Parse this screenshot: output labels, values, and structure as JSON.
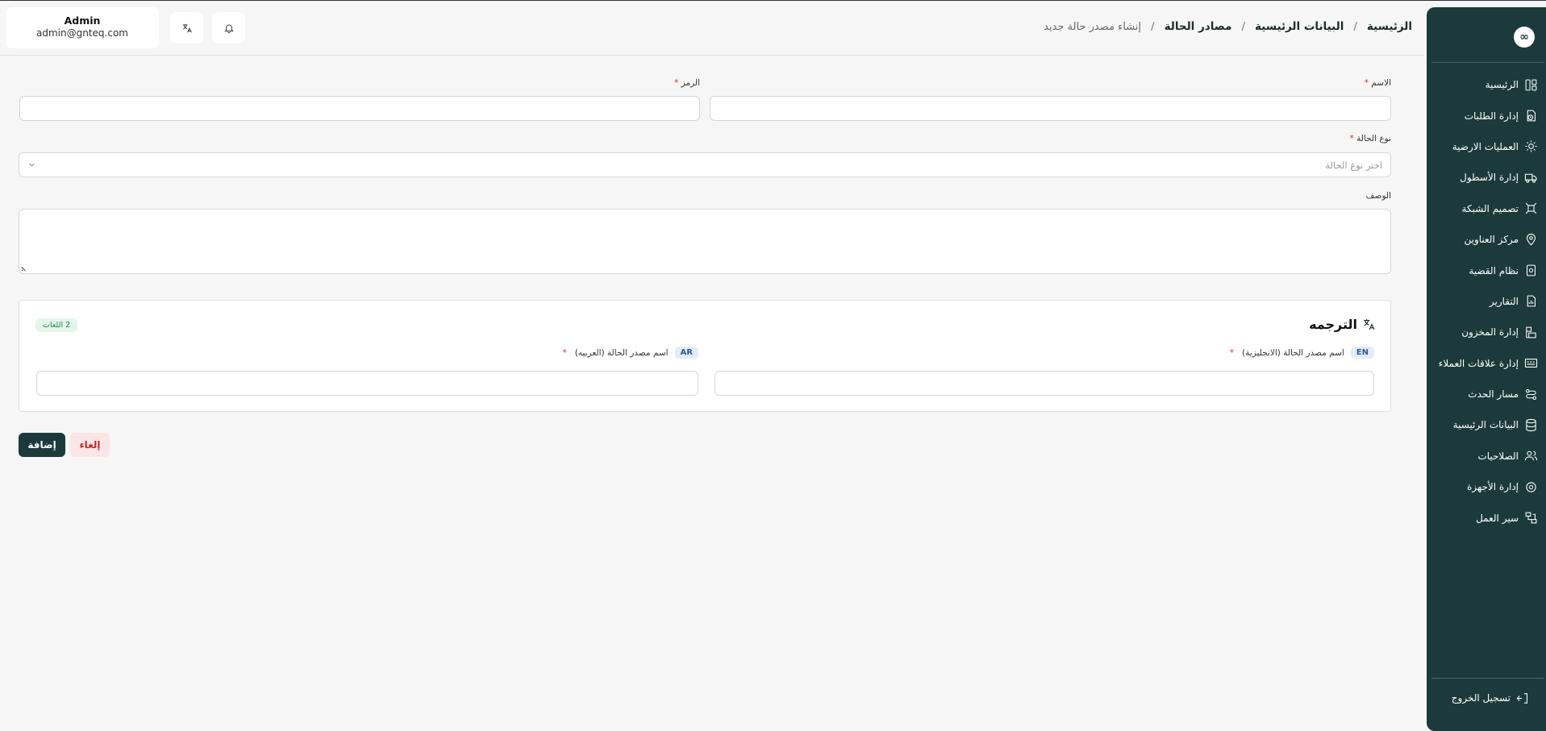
{
  "breadcrumb": {
    "home": "الرئيسية",
    "master_data": "البيانات الرئيسية",
    "status_sources": "مصادر الحالة",
    "current": "إنشاء مصدر حالة جديد",
    "separator": "/"
  },
  "user": {
    "name": "Admin",
    "email": "admin@gnteq.com"
  },
  "header_icons": [
    "translate-icon",
    "bell-icon"
  ],
  "sidebar": {
    "logo_symbol": "∞",
    "items": [
      {
        "label": "الرئيسية",
        "icon": "dashboard-icon"
      },
      {
        "label": "إدارة الطلبات",
        "icon": "orders-icon"
      },
      {
        "label": "العمليات الارضية",
        "icon": "ground-ops-icon"
      },
      {
        "label": "إدارة الأسطول",
        "icon": "truck-icon"
      },
      {
        "label": "تصميم الشبكة",
        "icon": "network-icon"
      },
      {
        "label": "مركز العناوين",
        "icon": "location-icon"
      },
      {
        "label": "نظام القضية",
        "icon": "case-icon"
      },
      {
        "label": "التقارير",
        "icon": "reports-icon"
      },
      {
        "label": "إدارة المخزون",
        "icon": "inventory-icon"
      },
      {
        "label": "إدارة علاقات العملاء",
        "icon": "crm-icon"
      },
      {
        "label": "مسار الحدث",
        "icon": "route-icon"
      },
      {
        "label": "البيانات الرئيسية",
        "icon": "database-icon"
      },
      {
        "label": "الصلاحيات",
        "icon": "users-icon"
      },
      {
        "label": "إدارة الأجهزة",
        "icon": "device-icon"
      },
      {
        "label": "سير العمل",
        "icon": "workflow-icon"
      }
    ],
    "logout": "تسجيل الخروج"
  },
  "form": {
    "name_label": "الاسم",
    "code_label": "الرمز",
    "status_type_label": "نوع الحالة",
    "status_type_placeholder": "اختر نوع الحالة",
    "description_label": "الوصف",
    "required_mark": "*"
  },
  "translation": {
    "title": "الترجمه",
    "badge": "2 اللغات",
    "en_tag": "EN",
    "en_label": "اسم مصدر الحالة (الانجليزية)",
    "ar_tag": "AR",
    "ar_label": "اسم مصدر الحالة (العربيه)"
  },
  "actions": {
    "add": "إضافة",
    "cancel": "إلغاء"
  },
  "colors": {
    "sidebar_bg": "#1c3a3c",
    "primary_button": "#1c3a3c",
    "cancel_bg": "#fbe5e7",
    "cancel_text": "#c62828",
    "badge_bg": "#e4f5ea",
    "badge_text": "#1f8a4c",
    "required": "#d32f2f"
  }
}
